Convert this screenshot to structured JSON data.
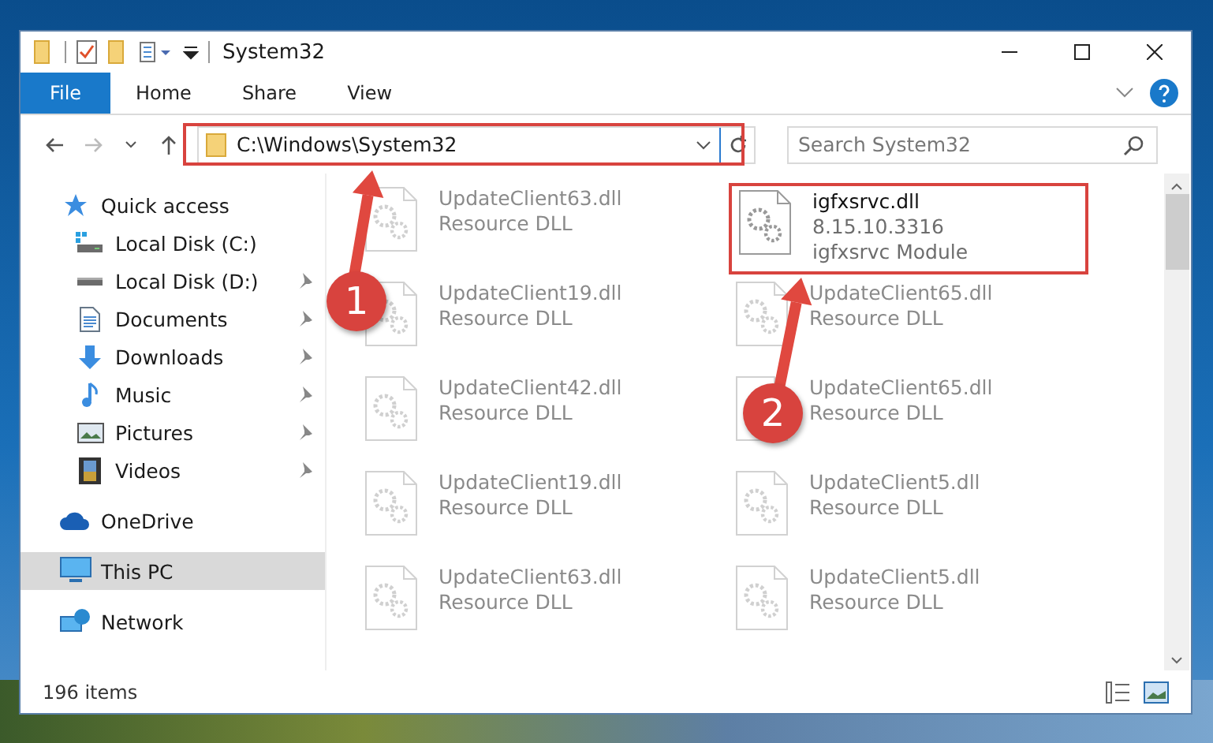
{
  "window": {
    "title": "System32"
  },
  "ribbon_tabs": [
    {
      "label": "File",
      "kind": "file",
      "selected": false
    },
    {
      "label": "Home",
      "kind": "tab",
      "selected": false
    },
    {
      "label": "Share",
      "kind": "tab",
      "selected": false
    },
    {
      "label": "View",
      "kind": "tab",
      "selected": false
    }
  ],
  "address": {
    "path": "C:\\Windows\\System32",
    "highlighted": true
  },
  "search": {
    "placeholder": "Search System32"
  },
  "nav": [
    {
      "label": "Quick access",
      "kind": "star",
      "selected": false,
      "children": [
        {
          "label": "Local Disk (C:)",
          "kind": "drive-c",
          "pinned": false,
          "selected": false
        },
        {
          "label": "Local Disk (D:)",
          "kind": "drive",
          "pinned": true,
          "selected": false
        },
        {
          "label": "Documents",
          "kind": "documents",
          "pinned": true,
          "selected": false
        },
        {
          "label": "Downloads",
          "kind": "downloads",
          "pinned": true,
          "selected": false
        },
        {
          "label": "Music",
          "kind": "music",
          "pinned": true,
          "selected": false
        },
        {
          "label": "Pictures",
          "kind": "pictures",
          "pinned": true,
          "selected": false
        },
        {
          "label": "Videos",
          "kind": "videos",
          "pinned": true,
          "selected": false
        }
      ]
    },
    {
      "label": "OneDrive",
      "kind": "cloud",
      "selected": false
    },
    {
      "label": "This PC",
      "kind": "pc",
      "selected": true
    },
    {
      "label": "Network",
      "kind": "network",
      "selected": false
    }
  ],
  "files": [
    {
      "name": "UpdateClient63.dll",
      "lines": [
        "Resource DLL"
      ],
      "highlighted": false
    },
    {
      "name": "igfxsrvc.dll",
      "lines": [
        "8.15.10.3316",
        "igfxsrvc Module"
      ],
      "highlighted": true
    },
    {
      "name": "UpdateClient19.dll",
      "lines": [
        "Resource DLL"
      ],
      "highlighted": false
    },
    {
      "name": "UpdateClient65.dll",
      "lines": [
        "Resource DLL"
      ],
      "highlighted": false
    },
    {
      "name": "UpdateClient42.dll",
      "lines": [
        "Resource DLL"
      ],
      "highlighted": false
    },
    {
      "name": "UpdateClient65.dll",
      "lines": [
        "Resource DLL"
      ],
      "highlighted": false
    },
    {
      "name": "UpdateClient19.dll",
      "lines": [
        "Resource DLL"
      ],
      "highlighted": false
    },
    {
      "name": "UpdateClient5.dll",
      "lines": [
        "Resource DLL"
      ],
      "highlighted": false
    },
    {
      "name": "UpdateClient63.dll",
      "lines": [
        "Resource DLL"
      ],
      "highlighted": false
    },
    {
      "name": "UpdateClient5.dll",
      "lines": [
        "Resource DLL"
      ],
      "highlighted": false
    }
  ],
  "status_bar": {
    "item_count": "196 items"
  },
  "annotations": [
    {
      "number": "1"
    },
    {
      "number": "2"
    }
  ]
}
